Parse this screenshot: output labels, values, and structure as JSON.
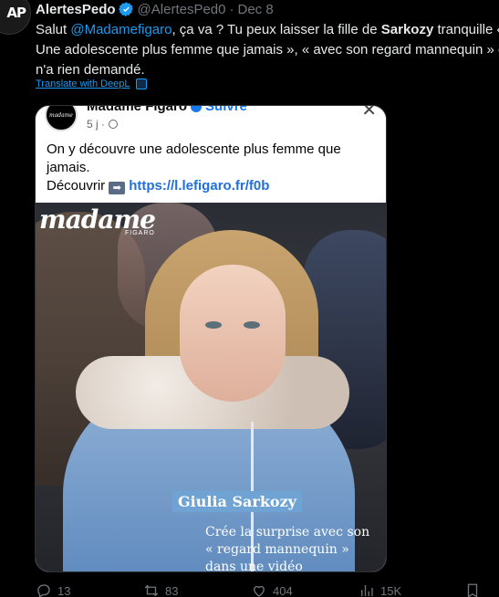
{
  "tweet": {
    "avatar_text": "AP",
    "author_name": "AlertesPedo",
    "handle": "@AlertesPed0",
    "dot": "·",
    "date": "Dec 8",
    "text_part1": "Salut ",
    "mention": "@Madamefigaro",
    "text_part2": ", ça va ? Tu peux laisser la fille de ",
    "bold_name": "Sarkozy",
    "text_part3": " tranquille « Une adolescente plus femme que jamais », « avec son regard mannequin » elle n'a rien demandé.",
    "translate_label": "Translate with DeepL"
  },
  "embed": {
    "page_name": "Madame Figaro",
    "follow_label": "Suivre",
    "time": "5 j ·",
    "post_text": "On y découvre une adolescente plus femme que jamais.",
    "discover_label": "Découvrir",
    "link": "https://l.lefigaro.fr/f0b",
    "brand": "madame",
    "brand_sub": "FIGARO",
    "caption_name": "Giulia Sarkozy",
    "caption_sub": "Crée la surprise avec son « regard mannequin » dans une vidéo"
  },
  "actions": {
    "replies": "13",
    "reposts": "83",
    "likes": "404",
    "views": "15K"
  },
  "colors": {
    "accent": "#1d9bf0",
    "background": "#000000",
    "muted": "#71767b"
  }
}
